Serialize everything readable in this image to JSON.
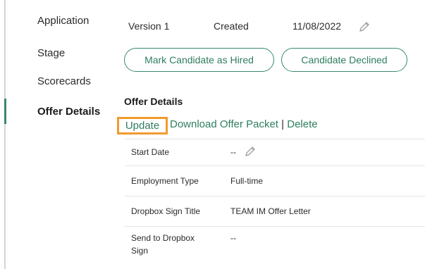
{
  "sidebar": {
    "items": [
      {
        "label": "Application"
      },
      {
        "label": "Stage"
      },
      {
        "label": "Scorecards"
      },
      {
        "label": "Offer Details",
        "active": true
      }
    ]
  },
  "version": {
    "label": "Version 1",
    "created_label": "Created",
    "created_date": "11/08/2022"
  },
  "buttons": {
    "mark_hired": "Mark Candidate as Hired",
    "declined": "Candidate Declined"
  },
  "offer": {
    "title": "Offer Details",
    "actions": {
      "update": "Update",
      "download": "Download Offer Packet",
      "separator": "|",
      "delete": "Delete"
    },
    "rows": [
      {
        "label": "Start Date",
        "value": "--"
      },
      {
        "label": "Employment Type",
        "value": "Full-time"
      },
      {
        "label": "Dropbox Sign Title",
        "value": "TEAM IM Offer Letter"
      },
      {
        "label": "Send to Dropbox Sign",
        "value": "--"
      }
    ]
  },
  "colors": {
    "accent_green": "#2f7d5f",
    "highlight_orange": "#f29a2e",
    "border_gray": "#e3e3e3"
  },
  "icons": [
    "pencil-icon"
  ]
}
